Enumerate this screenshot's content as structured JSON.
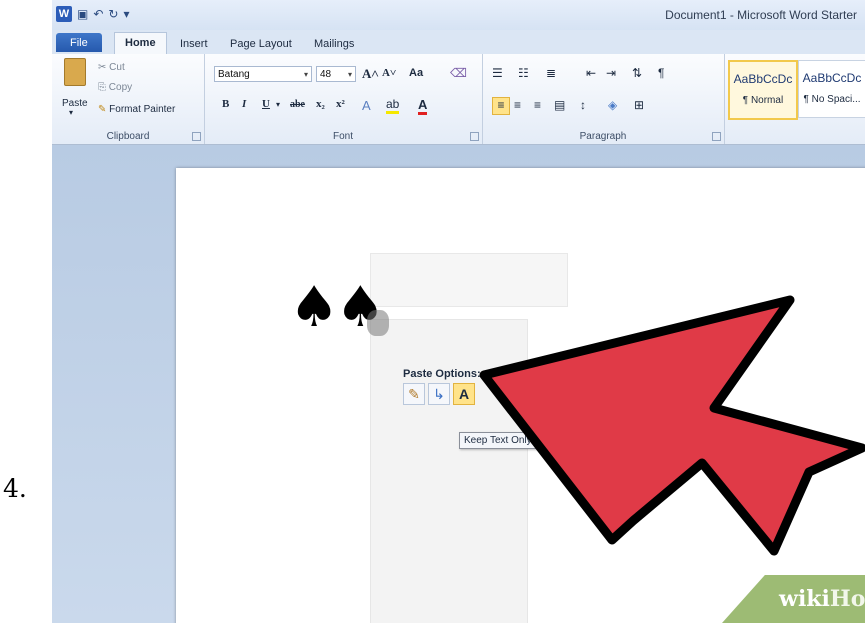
{
  "step_number": "4.",
  "window": {
    "title": "Document1 - Microsoft Word Starter"
  },
  "tabs": [
    "File",
    "Home",
    "Insert",
    "Page Layout",
    "Mailings"
  ],
  "clipboard": {
    "paste": "Paste",
    "cut": "Cut",
    "copy": "Copy",
    "format_painter": "Format Painter",
    "label": "Clipboard"
  },
  "font": {
    "name": "Batang",
    "size": "48",
    "label": "Font",
    "grow": "A˄",
    "shrink": "A˅",
    "case": "Aa",
    "bold": "B",
    "italic": "I",
    "underline": "U",
    "strike": "abe",
    "sub": "x₂",
    "sup": "x²"
  },
  "paragraph": {
    "label": "Paragraph"
  },
  "styles": [
    {
      "sample": "AaBbCcDc",
      "name": "¶ Normal"
    },
    {
      "sample": "AaBbCcDc",
      "name": "¶ No Spaci..."
    }
  ],
  "document": {
    "content": "♠♠"
  },
  "paste_options": {
    "title": "Paste Options:",
    "tooltip": "Keep Text Only (T)",
    "keep_text_glyph": "A"
  },
  "watermark": {
    "wiki": "wiki",
    "how": "How"
  },
  "colors": {
    "arrow_fill": "#e03a47",
    "arrow_outline": "#000000",
    "accent_file_tab": "#2e63b6",
    "watermark_bg": "#9dbb74"
  }
}
